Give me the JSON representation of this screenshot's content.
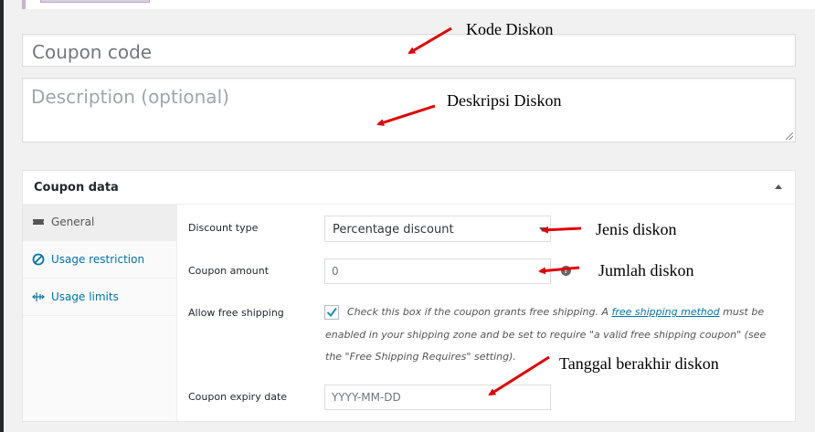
{
  "coupon": {
    "code_placeholder": "Coupon code",
    "description_placeholder": "Description (optional)"
  },
  "panel": {
    "title": "Coupon data",
    "tabs": [
      {
        "label": "General",
        "icon": "ticket-icon",
        "active": true
      },
      {
        "label": "Usage restriction",
        "icon": "restriction-icon",
        "active": false
      },
      {
        "label": "Usage limits",
        "icon": "limits-icon",
        "active": false
      }
    ]
  },
  "general": {
    "discount_type_label": "Discount type",
    "discount_type_value": "Percentage discount",
    "coupon_amount_label": "Coupon amount",
    "coupon_amount_value": "0",
    "free_shipping_label": "Allow free shipping",
    "free_shipping_checked": true,
    "free_shipping_desc_1": "Check this box if the coupon grants free shipping. A",
    "free_shipping_link": "free shipping method",
    "free_shipping_desc_2": "must be",
    "free_shipping_desc_3": "enabled in your shipping zone and be set to require \"a valid free shipping coupon\" (see",
    "free_shipping_desc_4": "the \"Free Shipping Requires\" setting).",
    "expiry_label": "Coupon expiry date",
    "expiry_placeholder": "YYYY-MM-DD"
  },
  "annotations": {
    "kode": "Kode Diskon",
    "deskripsi": "Deskripsi Diskon",
    "jenis": "Jenis diskon",
    "jumlah": "Jumlah diskon",
    "tanggal": "Tanggal berakhir diskon"
  },
  "colors": {
    "arrow": "#e00000",
    "link": "#0073aa"
  }
}
